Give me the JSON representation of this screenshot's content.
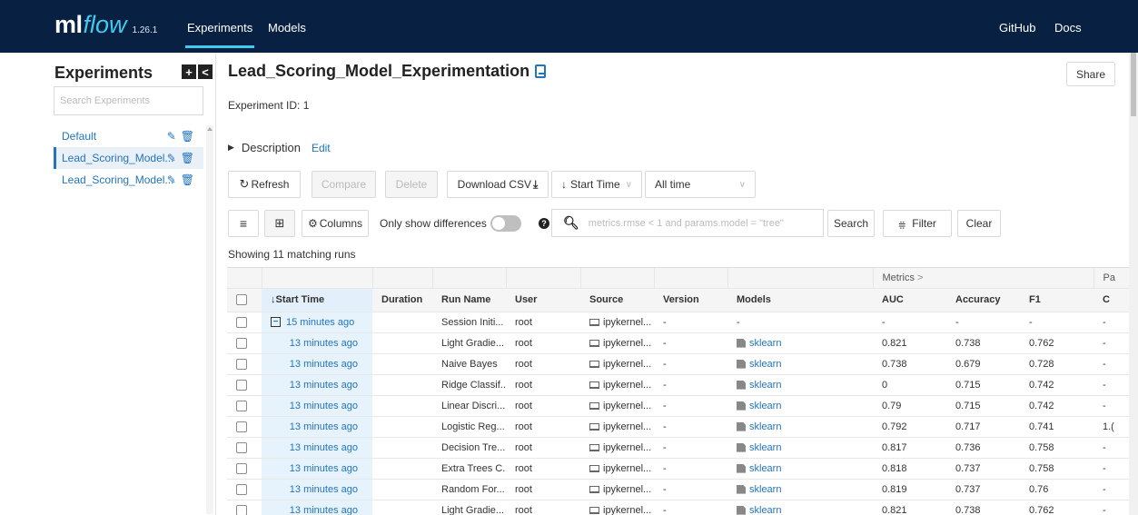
{
  "brand": {
    "name_ml": "ml",
    "name_flow": "flow",
    "version": "1.26.1"
  },
  "nav": {
    "experiments": "Experiments",
    "models": "Models",
    "github": "GitHub",
    "docs": "Docs"
  },
  "sidebar": {
    "title": "Experiments",
    "add_label": "+",
    "collapse_label": "<",
    "search_placeholder": "Search Experiments",
    "items": [
      {
        "label": "Default"
      },
      {
        "label": "Lead_Scoring_Model..."
      },
      {
        "label": "Lead_Scoring_Model..."
      }
    ],
    "edit_glyph": "✎",
    "delete_glyph": "🗑"
  },
  "experiment": {
    "title": "Lead_Scoring_Model_Experimentation",
    "share_label": "Share",
    "id_text": "Experiment ID: 1",
    "description_label": "Description",
    "edit_label": "Edit"
  },
  "toolbar": {
    "refresh": "Refresh",
    "compare": "Compare",
    "delete": "Delete",
    "download_csv": "Download CSV",
    "sort_select": "Start Time",
    "time_select": "All time",
    "columns": "Columns",
    "only_diff": "Only show differences",
    "search_placeholder": "metrics.rmse < 1 and params.model = \"tree\"",
    "search": "Search",
    "filter": "Filter",
    "clear": "Clear"
  },
  "showing_text": "Showing 11 matching runs",
  "table": {
    "group_metrics": "Metrics",
    "group_params": "Pa",
    "headers": [
      "Start Time",
      "Duration",
      "Run Name",
      "User",
      "Source",
      "Version",
      "Models",
      "AUC",
      "Accuracy",
      "F1",
      "C"
    ],
    "rows": [
      {
        "start": "15 minutes ago",
        "run": "Session Initi...",
        "user": "root",
        "source": "ipykernel...",
        "version": "-",
        "models": "-",
        "auc": "-",
        "acc": "-",
        "f1": "-",
        "c": "-"
      },
      {
        "start": "13 minutes ago",
        "run": "Light Gradie...",
        "user": "root",
        "source": "ipykernel...",
        "version": "-",
        "models": "sklearn",
        "auc": "0.821",
        "acc": "0.738",
        "f1": "0.762",
        "c": "-"
      },
      {
        "start": "13 minutes ago",
        "run": "Naive Bayes",
        "user": "root",
        "source": "ipykernel...",
        "version": "-",
        "models": "sklearn",
        "auc": "0.738",
        "acc": "0.679",
        "f1": "0.728",
        "c": "-"
      },
      {
        "start": "13 minutes ago",
        "run": "Ridge Classif...",
        "user": "root",
        "source": "ipykernel...",
        "version": "-",
        "models": "sklearn",
        "auc": "0",
        "acc": "0.715",
        "f1": "0.742",
        "c": "-"
      },
      {
        "start": "13 minutes ago",
        "run": "Linear Discri...",
        "user": "root",
        "source": "ipykernel...",
        "version": "-",
        "models": "sklearn",
        "auc": "0.79",
        "acc": "0.715",
        "f1": "0.742",
        "c": "-"
      },
      {
        "start": "13 minutes ago",
        "run": "Logistic Reg...",
        "user": "root",
        "source": "ipykernel...",
        "version": "-",
        "models": "sklearn",
        "auc": "0.792",
        "acc": "0.717",
        "f1": "0.741",
        "c": "1.("
      },
      {
        "start": "13 minutes ago",
        "run": "Decision Tre...",
        "user": "root",
        "source": "ipykernel...",
        "version": "-",
        "models": "sklearn",
        "auc": "0.817",
        "acc": "0.736",
        "f1": "0.758",
        "c": "-"
      },
      {
        "start": "13 minutes ago",
        "run": "Extra Trees C...",
        "user": "root",
        "source": "ipykernel...",
        "version": "-",
        "models": "sklearn",
        "auc": "0.818",
        "acc": "0.737",
        "f1": "0.758",
        "c": "-"
      },
      {
        "start": "13 minutes ago",
        "run": "Random For...",
        "user": "root",
        "source": "ipykernel...",
        "version": "-",
        "models": "sklearn",
        "auc": "0.819",
        "acc": "0.737",
        "f1": "0.76",
        "c": "-"
      },
      {
        "start": "13 minutes ago",
        "run": "Light Gradie...",
        "user": "root",
        "source": "ipykernel...",
        "version": "-",
        "models": "sklearn",
        "auc": "0.821",
        "acc": "0.738",
        "f1": "0.762",
        "c": "-"
      }
    ]
  }
}
